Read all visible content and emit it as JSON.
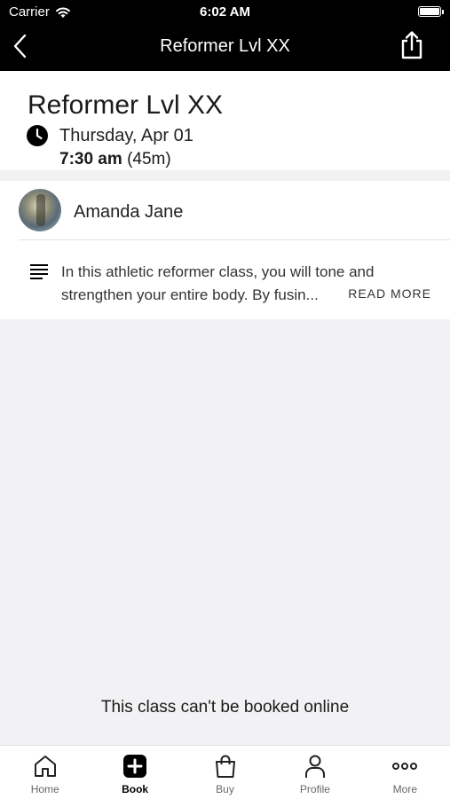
{
  "status_bar": {
    "carrier": "Carrier",
    "time": "6:02 AM"
  },
  "nav": {
    "title": "Reformer Lvl XX"
  },
  "class": {
    "title": "Reformer Lvl XX",
    "date": "Thursday, Apr 01",
    "time": "7:30 am",
    "duration": "(45m)"
  },
  "instructor": {
    "name": "Amanda Jane"
  },
  "description": {
    "text": "In this athletic reformer class, you will tone and strengthen your entire body. By fusin...",
    "read_more": "READ MORE"
  },
  "notice": "This class can't be booked online",
  "tabs": [
    {
      "label": "Home",
      "icon": "home-icon",
      "active": false
    },
    {
      "label": "Book",
      "icon": "plus-square-icon",
      "active": true
    },
    {
      "label": "Buy",
      "icon": "shopping-bag-icon",
      "active": false
    },
    {
      "label": "Profile",
      "icon": "person-icon",
      "active": false
    },
    {
      "label": "More",
      "icon": "more-dots-icon",
      "active": false
    }
  ]
}
